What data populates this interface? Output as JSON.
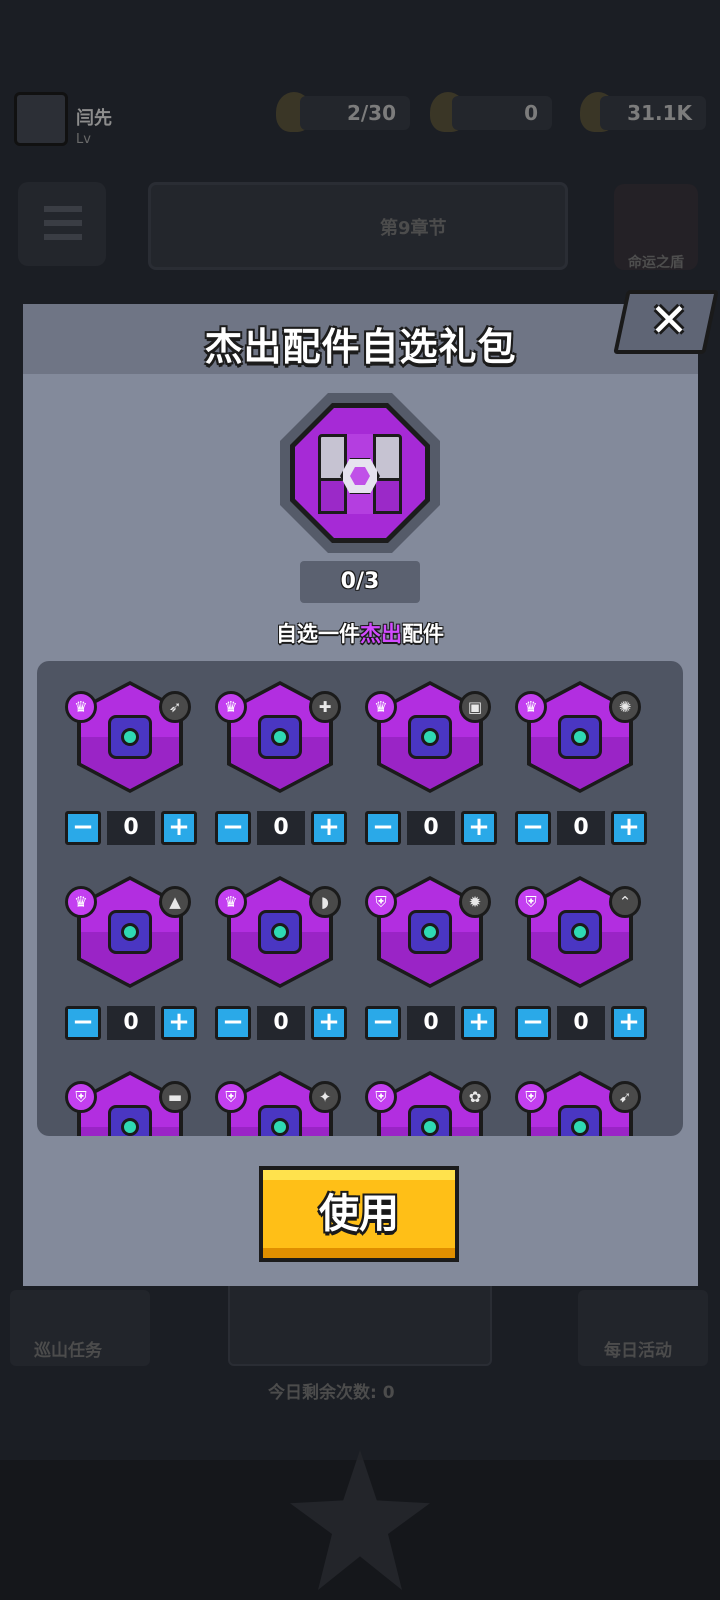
{
  "background": {
    "player_name": "闫先",
    "player_level": "Lv",
    "resources": [
      {
        "name": "energy",
        "value": "2/30"
      },
      {
        "name": "gems",
        "value": "0"
      },
      {
        "name": "coins",
        "value": "31.1K"
      }
    ],
    "banner_text": "第9章节",
    "shield_label": "命运之盾",
    "bottom_left_label": "巡山任务",
    "bottom_right_label": "每日活动",
    "bottom_mid_label": "今日剩余次数: 0"
  },
  "modal": {
    "title": "杰出配件自选礼包",
    "close_label": "✕",
    "progress": "0/3",
    "subtitle_before": "自选一件",
    "subtitle_accent": "杰出",
    "subtitle_after": "配件",
    "accent_color": "#d24bff",
    "use_button_label": "使用"
  },
  "items": [
    {
      "badge": "♛",
      "type_icon": "➶",
      "count": "0"
    },
    {
      "badge": "♛",
      "type_icon": "✚",
      "count": "0"
    },
    {
      "badge": "♛",
      "type_icon": "▣",
      "count": "0"
    },
    {
      "badge": "♛",
      "type_icon": "✺",
      "count": "0"
    },
    {
      "badge": "♛",
      "type_icon": "▲",
      "count": "0"
    },
    {
      "badge": "♛",
      "type_icon": "◗",
      "count": "0"
    },
    {
      "badge": "⛨",
      "type_icon": "✹",
      "count": "0"
    },
    {
      "badge": "⛨",
      "type_icon": "⌃",
      "count": "0"
    },
    {
      "badge": "⛨",
      "type_icon": "▬",
      "count": ""
    },
    {
      "badge": "⛨",
      "type_icon": "✦",
      "count": ""
    },
    {
      "badge": "⛨",
      "type_icon": "✿",
      "count": ""
    },
    {
      "badge": "⛨",
      "type_icon": "➹",
      "count": ""
    }
  ],
  "stepper": {
    "minus_label": "−",
    "plus_label": "+"
  }
}
